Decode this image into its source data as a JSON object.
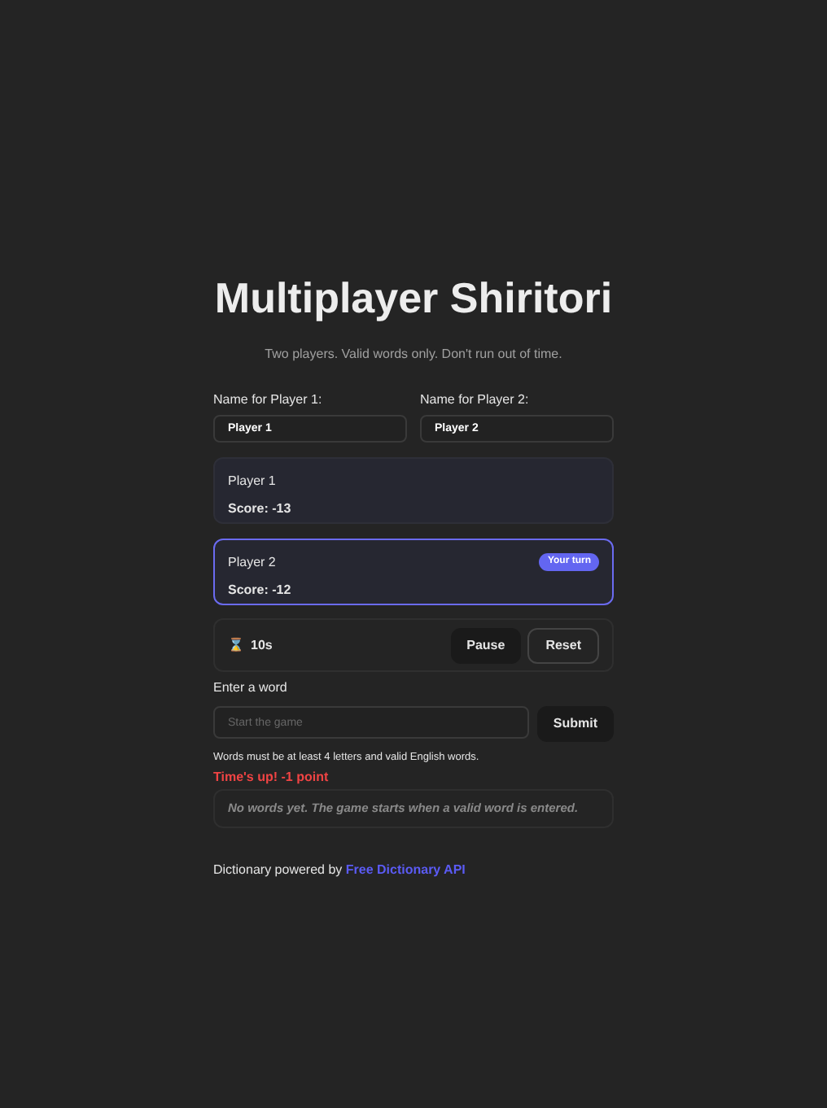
{
  "title": "Multiplayer Shiritori",
  "subtitle": "Two players. Valid words only. Don't run out of time.",
  "name_fields": [
    {
      "label": "Name for Player 1:",
      "value": "Player 1"
    },
    {
      "label": "Name for Player 2:",
      "value": "Player 2"
    }
  ],
  "players": [
    {
      "name": "Player 1",
      "score": "Score: -13",
      "selected": false
    },
    {
      "name": "Player 2",
      "score": "Score: -12",
      "selected": true,
      "badge": "Your turn"
    }
  ],
  "timer": {
    "icon": "⌛",
    "time": "10s",
    "buttons": [
      {
        "label": "Pause",
        "kind": "filled"
      },
      {
        "label": "Reset",
        "kind": "outline"
      }
    ]
  },
  "word_input": {
    "label": "Enter a word",
    "placeholder": "Start the game",
    "button": "Submit"
  },
  "hint": "Words must be at least 4 letters and valid English words.",
  "error": "Time's up! -1 point",
  "history_empty": "No words yet. The game starts when a valid word is entered.",
  "footer": {
    "text": "Dictionary powered by",
    "link": "Free Dictionary API"
  }
}
